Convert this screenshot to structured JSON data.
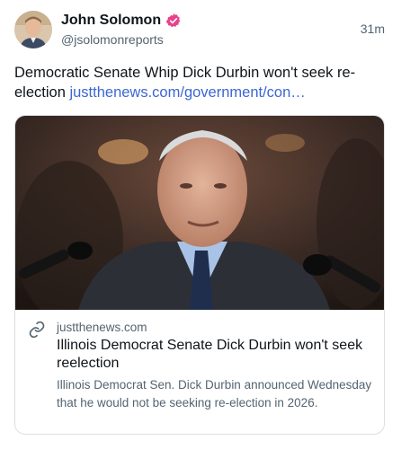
{
  "author": {
    "name": "John Solomon",
    "handle": "@jsolomonreports",
    "verified_icon": "verified-badge-icon",
    "verified_color": "#e8428a"
  },
  "post": {
    "timestamp": "31m",
    "text": "Democratic Senate Whip Dick Durbin won't seek re-election",
    "link_text": "justthenews.com/government/con…",
    "link_color": "#3b66d4"
  },
  "card": {
    "domain": "justthenews.com",
    "title": "Illinois Democrat Senate Dick Durbin won't seek reelection",
    "description": "Illinois Democrat Sen. Dick Durbin announced Wednesday that he would not be seeking re-election in 2026.",
    "icon": "link-icon"
  }
}
